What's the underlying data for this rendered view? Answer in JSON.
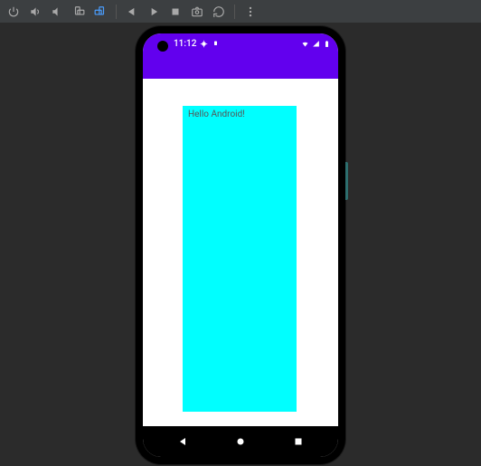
{
  "toolbar": {
    "icons": {
      "power": "power-icon",
      "volume_up": "volume-up-icon",
      "volume_down": "volume-down-icon",
      "rotate_left": "rotate-left-icon",
      "rotate_right": "rotate-right-icon",
      "prev": "back-step-icon",
      "next": "forward-step-icon",
      "stop": "stop-icon",
      "screenshot": "camera-icon",
      "restart": "restart-icon",
      "more": "more-icon"
    }
  },
  "statusbar": {
    "time": "11:12",
    "icons_left": [
      "debug",
      "mute"
    ],
    "icons_right": [
      "wifi",
      "signal",
      "battery"
    ]
  },
  "app": {
    "greeting": "Hello Android!",
    "box_color": "#00ffff",
    "actionbar_color": "#6200ee"
  },
  "nav": {
    "back": "back",
    "home": "home",
    "recents": "recents"
  }
}
